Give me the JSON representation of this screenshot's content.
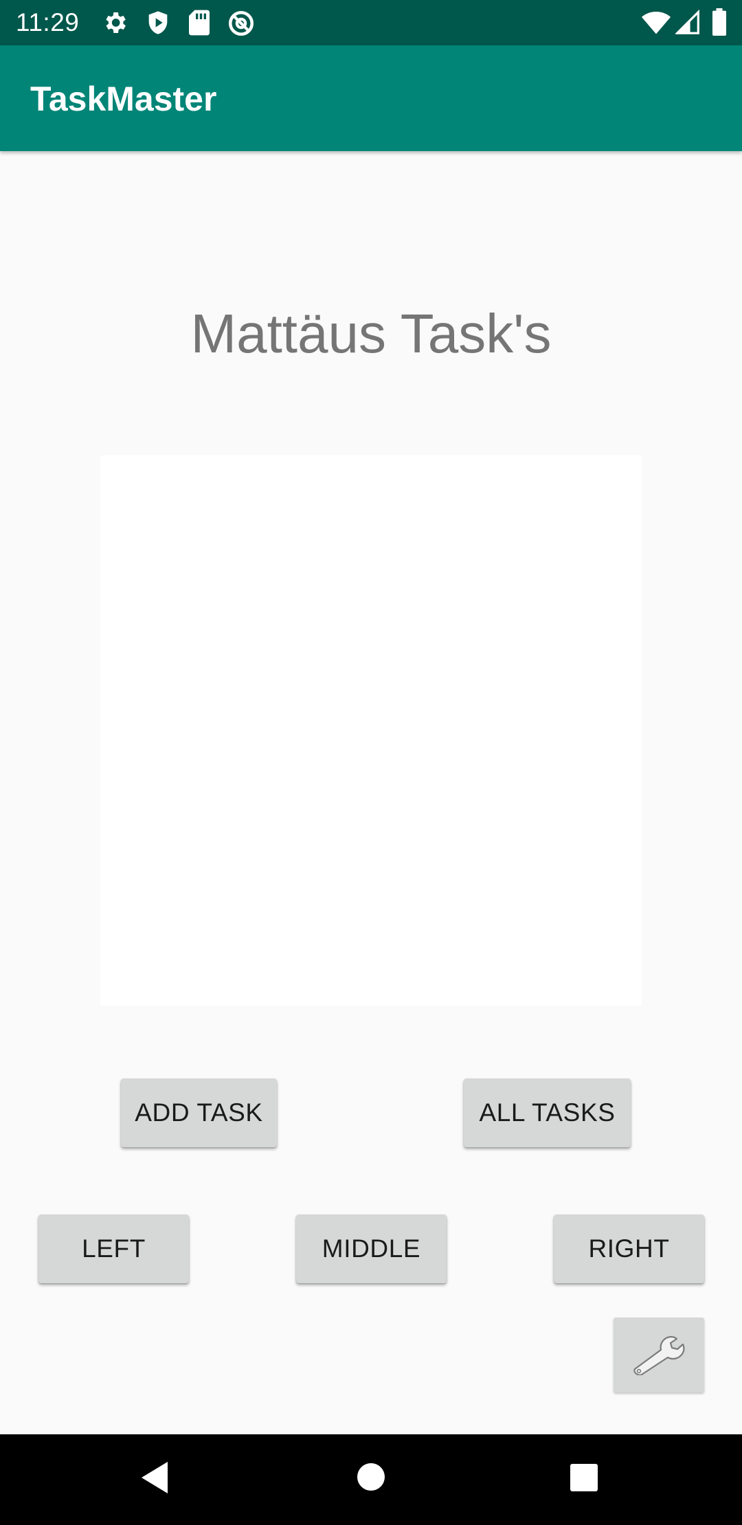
{
  "status_bar": {
    "time": "11:29",
    "left_icons": [
      "gear-icon",
      "shield-icon",
      "sd-card-icon",
      "at-sign-icon"
    ],
    "right_icons": [
      "wifi-icon",
      "signal-icon",
      "battery-icon"
    ]
  },
  "app_bar": {
    "title": "TaskMaster",
    "color": "#008577"
  },
  "main": {
    "heading": "Mattäus Task's",
    "task_list": []
  },
  "buttons": {
    "add_task": "ADD TASK",
    "all_tasks": "ALL TASKS",
    "left": "LEFT",
    "middle": "MIDDLE",
    "right": "RIGHT",
    "settings_icon": "wrench-icon"
  },
  "nav_bar": {
    "items": [
      "back-icon",
      "home-icon",
      "recents-icon"
    ]
  }
}
